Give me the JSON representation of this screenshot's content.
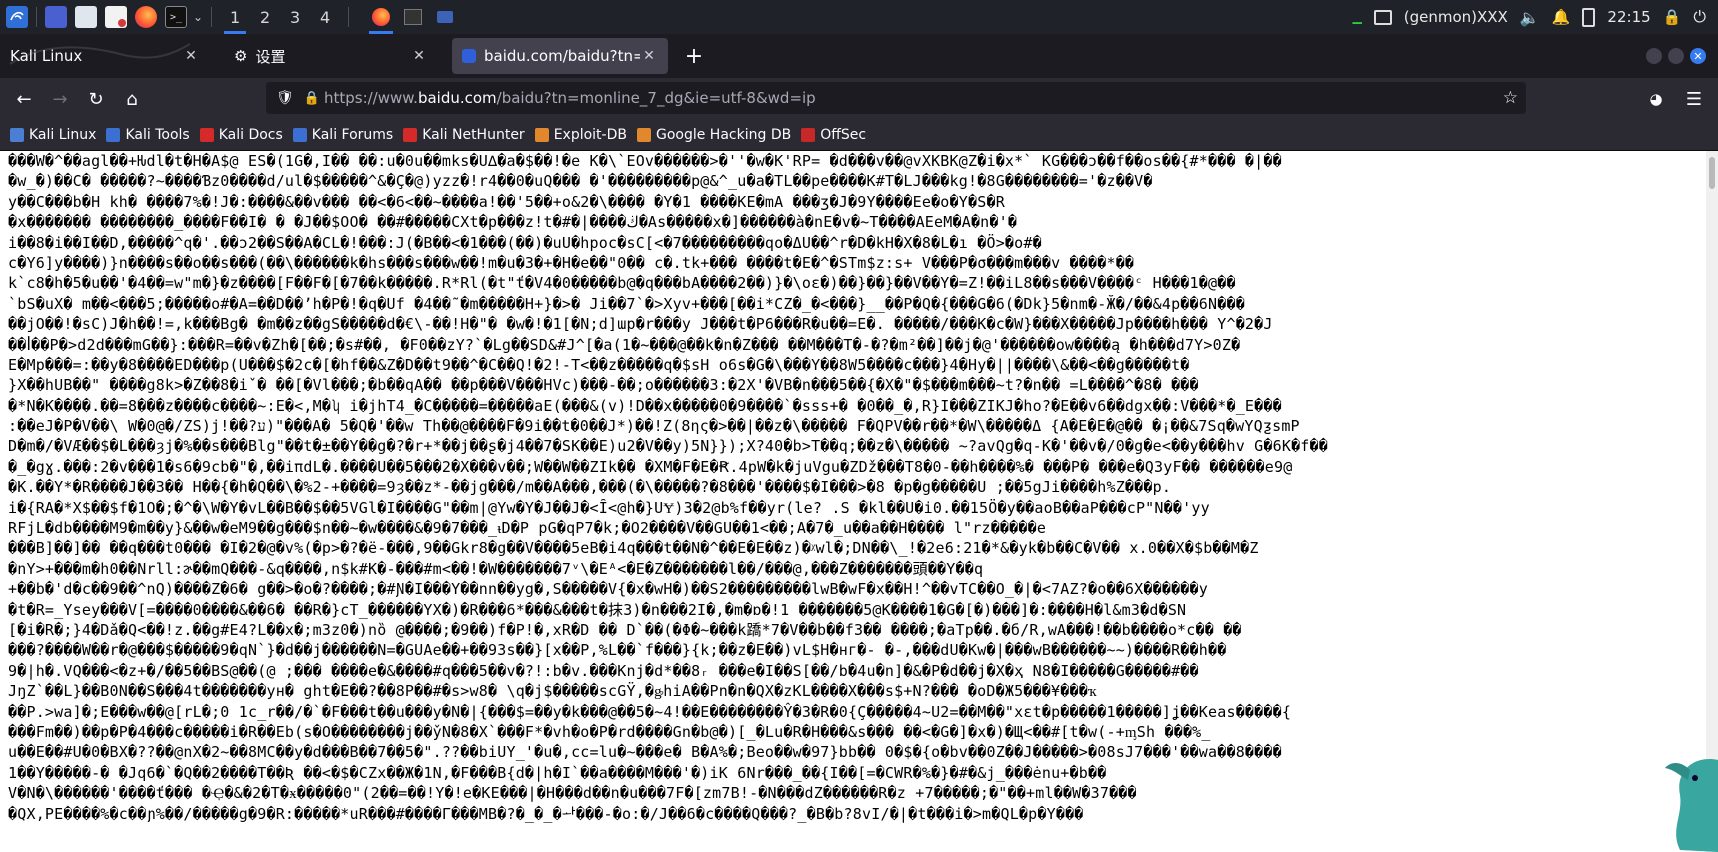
{
  "panel": {
    "workspaces": [
      "1",
      "2",
      "3",
      "4"
    ],
    "active_workspace": 0,
    "genmon": "(genmon)XXX",
    "clock": "22:15"
  },
  "tabs": [
    {
      "label": "Kali Linux",
      "selected": false
    },
    {
      "label": "设置",
      "selected": false
    },
    {
      "label": "baidu.com/baidu?tn=mon",
      "selected": true
    }
  ],
  "url": {
    "prefix": "https://www.",
    "domain": "baidu.com",
    "path": "/baidu?tn=monline_7_dg&ie=utf-8&wd=ip"
  },
  "bookmarks": [
    {
      "label": "Kali Linux",
      "color": "#4a7fd4"
    },
    {
      "label": "Kali Tools",
      "color": "#3b6fd1"
    },
    {
      "label": "Kali Docs",
      "color": "#d42a2a"
    },
    {
      "label": "Kali Forums",
      "color": "#3b6fd1"
    },
    {
      "label": "Kali NetHunter",
      "color": "#d42a2a"
    },
    {
      "label": "Exploit-DB",
      "color": "#e0882b"
    },
    {
      "label": "Google Hacking DB",
      "color": "#e0882b"
    },
    {
      "label": "OffSec",
      "color": "#c82828"
    }
  ],
  "content_lines": [
    "���W�^��agl��+Ƕdl�t�H�A$@ ES�(1G�,I�� ��:u�0u��mks�U∆�a�$��!�e K�\\`EOv������>�''�w�K'RP= �d���v��@vXKBK@Z�i�x*` KG���ɔ��f��os��{#*��� �|��",
    "�w_�)��C� �����?~����Ɓz0����d/ul�$�����^&�Ç�@)yzz�!r4��0�uQ��� �'���������p@&^_u�a�TL��pe����K#T�LJ���kg!�8G��������='�z��V�",
    "y��C���b�H kh� ����7%�!J�:����&��v��� ��<�6<��~����a!��'5��+o&2�\\���� �Y�1 ����KE�mA ���ʒ�J�9Y����Ee�o�Y�S�R",
    "�x������� ��������_����F��I� � �J��$OO� ��#�����CXt�p���z!t�#�|����ڬ�As�����x�]������à�nE�v�~T����AEeM�A�n�'�",
    "i��8�i��I��D,�����^q�'.��ɔ2��S��A�CL�!���:J(�B��<�1���(��)�uU�hpoc�sC[<�7���������qo�ΔU��^r�D�kH�X�8�L�ı �Ö>�o#�",
    "c�Y6]y����)}n����s��o��s���(��\\������k�hs���s���w��!m�u�3�+�H�e��\"0�� c�.tk+��� ����t�E�^�STm$z:s+ V���P�σ���m���v ����*��",
    "k`c8�h�5�u��'�4��=w\"m�}�z����[F��F�[�7��k�����.R*Rl(�t\"ť�V4�0�����b@�q���bA����2��)}�\\oɛ�)��}��}��V��Y�=Z!��iL8��s���V����ᶜ H���1�@��",
    "`bS�uX� m��<���5;�����o#�A=��D��ʼh�P�!�q�Uf �4��˜�m�����H+}�>� Ji��7`�>Xyv+���[��i*CZ�_�<���}__��P�Q�{���G�6(�Dk}5�nm�-Ӂ�/��&4p��6N���",
    "��jO��!�sC)J�h��!=,k���Bg� �m��z��gS�����d�€\\-��!H�\"� �w�!�1[�N;d]ɯp�r���y J���t�P6���R�u��=E�. �����/���K�c�W}���X�����Jp����h��� Y^�2�J",
    "��ꟾ��P�>d2d���mG��}:���R=��v�Zh�[��;�s#��, �F0��zY?`�Lg��SD&#J^[�a(1�~���@��k�n�Z��� ��M���T�-�?�m²��]��j�@'������ow����ą �h���d7Y>0Z�",
    "E�Mp���=:��y�8����ED���p(U���$�2c�[�hf��&Z�D��t9��^�C��Q!�2ǃ-T<��z�����q�$sH o6s�G�\\���Y��8W5����c���}4�Hy�||����\\&��<��g�����t�",
    "}X��hUB��\" ����g8k>�Z��8�iˇ� ��[�Vl���;�b��qA�� ��p���V���HVc)���-��;o������3:�2X'�VB�n���5��{�X�\"�$���m���~t?�n�� =L����^�8� ���",
    "�*N�K����.��=8���z����c����~:E�<,M�ʮ i�jhT4_�C�����=�����aE(���&(v)!D��x�����0�9����`�sss+� �0��_�,R}I���ZIKJ�ho?�E��v6��dgx��:V���*�_E���",
    ":��eJ�P�V��\\ W�0@�/ZS)j!��?ע)\"���A� 5�Q�'��w Th��@����F�9i��t�0��J*)��!Z(8ης�>��|��z�\\����� F�QPV��r��*�W\\�����Δ {A�E�E�@�� �¡��&7Sq�wYQƺsmP",
    "D�m�/�VӔ��$�L���ȝj�%��s���Blg\"��t�±��Y��g�?�r+*��j��ʂ�j4��7�SK��E)u2�V��y)5N}});X?40�b>T��q;��z�\\����� ~?avQg�q-K�'��v�/0�g�e<��y���hv G�6K�f��",
    "�_�gɣ.���:2�v���1�s6�9cb�\"�,��iπdL�.����U��5���2�X���v��;W��W��ZIk�� �XM�F�E�Ꞧ.4pW�k�juVgu�ZDž���T8�0-��h����%� ���P� ���e�Q3yF�� ������e9@",
    "�K.��Y*�R����J��3�� H��{�h�Q��\\�%2-+����=9ȝ��z*-��jg���/m��A���,���(�\\�����?�8���'����$�I���>�8 �p�g�����U ;��5gJi����h%Z���p.",
    "i�{RA�*X$��$f�1O�;�^�\\W�Y�vL��B��$��5VGl�I����G\"��m|@Yw�Y�J��J�<Ȋ<@h�}UɎ)3�2@b%f��yr(le? .S �kl��U�i0.��15Ö�y��aoB��aP���cP\"N��'yy",
    "RFjL�db����M9�m��y}&��w�eM9��g���$n��~�w����&�9�7���_ᵼD�P pG�qP7�k;�O2����V��GU��1<��;A�7�_u��a��H���� l\"rz�����e",
    "���B]��]�� ��q���t0��� �I�2�@�v%(�p>�?�ë-���,9��Gkr8�g��V����5eB�i4q���t��N�^��E�E��z)�ᵡwl�;DN��\\_!�2e6:21�*&�yk�b��C�V�� x.0��X�$b��M�Z",
    "�nY>+���m�h0��Nrll:ɚ��mQ���-&q����,n$k#K�-���#m<��!�W�������7ᵛ\\�Eᴬ<�E�Z�������l��/���@,���Z�������頭��Y��q",
    "+��b�'d�c��9��^nQ)����Z�6� g��>�o�?����;�#Ɲ�I���Y��nn��yg�,S�����V{�x�wH�)��S2���������lwB�wF�x��H!^��vTC��O_�|�<7AZ?�o��6X������y",
    "�t�R=_Ysey���V[=����0����&��6� ��R�}cT_������YX�)�R���6*���&���t�抹3)�n���2I�,�m�ɒ�!1 �������5@K����1�G�[�)���]�:����H�l&m3�d�SN",
    "[�i�R�;}4�Dǎ�Q<��!z.��g#E4?L��x�;m3z0�)nȍ @����;�9��)f�P!�,xR�D �� D`��(�Φ�~���k蹻*7�V��b��f3�� ����;�aTp��.�б/R,wA���!��b����o*c�� ��",
    "���?����W��r�@���$�����9�qN`}�d��j������N=�GUAe��+��93s��}[x��P,%L��`f���}{k;��z�E��)vL$H�нг�- �-,���dU�Kw�|���wB������~~)����R��h��",
    "9�|h�.VQ���<�z+�/��5��BS@��(@ ;��� ����e�&����#q���5��v�?!:b�v.���Knj�d*��8ᵣ ���e�I��S[��/b�4u�n]�&�P�d��j�X�ҳ N8�I�����G�����#��",
    "JŋZ`��L}��B0N��S���4t�������yн� ght�E��?��8P��#�s>w8� \\q�j$�����scGŸ,�ᶃhiA��Pn�n�QX�zKL����X���s$+N?��� �oD�Ж5���¥���ҡ",
    "��P.>wa]�;E���w��@[rL�;0 1c_r��/�`�F���t��u���y�N�|{���$=��y�k���@��5�~4!��E��������Ŷ�3�R�0{Ç�����4~U2=��M��\"xɛt�p�����1�����]ʝ��Keas�����{",
    "���Fm��)��p�P�4���c�����i�R��Eb(s�O��������j��y̌N�8�X`���F*�vh�o�P�rd����Gn�b@�)[_�Lu�R�H���&s��� ��<�G�]�x�)�Щ<��#[t�w(-+ᶆSh ���%_",
    "u��E��#U�0�BX�??��@nX�2~��8MC��y�d���B��7��5�\".??��biUY_'�u�,cc=lu�~���e� B�A%�;Beo��w�97}bb�� 0�$�{o�bv��0Z��J�����>�08sJ7���'��wa��8����",
    "1��Y�����-� �Jq6�`�Q��2����T��Ʀ ��<�$�CZx��Ж�1N,�F���B{d�|h�I`��a����M���'�)iK 6Nr���_��{I��[=�CWR�%�}�#�&j_���ėnu+�b��",
    "V�N�\\������'����ť��� �Ҿ�&�2�T�ӿ�����0\"(2��=��!Y�!e�KE���|�H���d��n�u���7F�[zm7B!-�N���dZ������R�z +7�����;�\"��+ml��W�37���",
    "�QX,PE����%�c��ɲ%��/�����g�9�R:�����*uR���#����Γ���MB�?�_�_�ᅪ���-�o:�/J��6�c����Q���?_�B�b?8vI/�|�t���i�>m�QL�p�Y���"
  ]
}
